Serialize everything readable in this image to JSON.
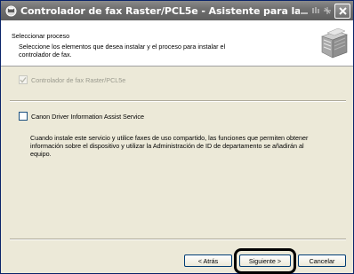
{
  "window": {
    "title": "Controlador de fax Raster/PCL5e - Asistente para la instalación"
  },
  "header": {
    "title": "Seleccionar proceso",
    "subtitle": "Seleccione los elementos que desea instalar y el proceso para instalar el controlador de fax."
  },
  "options": [
    {
      "label": "Controlador de fax Raster/PCL5e",
      "checked": true,
      "enabled": false
    },
    {
      "label": "Canon Driver Information Assist Service",
      "checked": false,
      "enabled": true
    }
  ],
  "description": "Cuando instale este servicio y utilice faxes de uso compartido, las funciones que permiten obtener información sobre el dispositivo y utilizar la Administración de ID de departamento se añadirán al equipo.",
  "buttons": {
    "back": "< Atrás",
    "next": "Siguiente >",
    "cancel": "Cancelar"
  },
  "icons": {
    "title_icon": "printer-setup-icon",
    "header_art": "printer-stack-icon",
    "close": "close-icon"
  }
}
